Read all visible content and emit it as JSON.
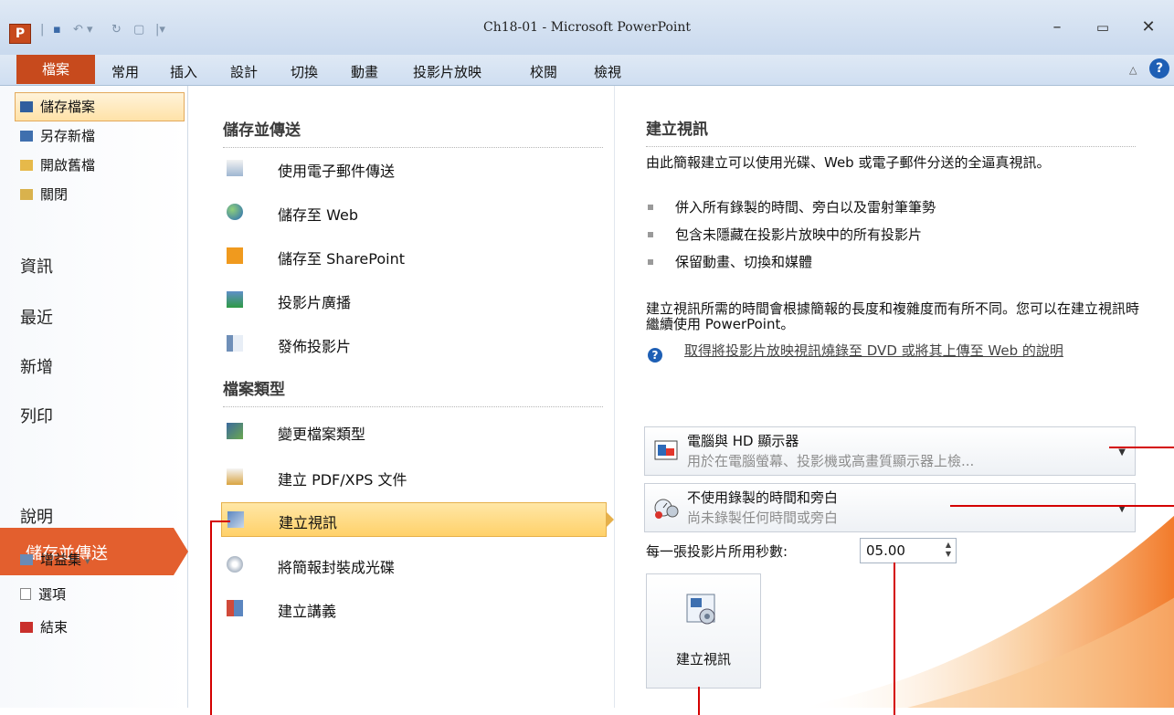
{
  "window": {
    "title": "Ch18-01 - Microsoft PowerPoint",
    "app_logo": "P",
    "controls": [
      "minimize-icon",
      "maximize-icon",
      "close-icon"
    ]
  },
  "ribbon": {
    "tabs": [
      "檔案",
      "常用",
      "插入",
      "設計",
      "切換",
      "動畫",
      "投影片放映",
      "校閱",
      "檢視"
    ],
    "help_icon": "?"
  },
  "sidebar": {
    "commands": [
      {
        "label": "儲存檔案",
        "icon": "save-icon"
      },
      {
        "label": "另存新檔",
        "icon": "save-as-icon"
      },
      {
        "label": "開啟舊檔",
        "icon": "open-folder-icon"
      },
      {
        "label": "關閉",
        "icon": "close-folder-icon"
      }
    ],
    "nav": [
      "資訊",
      "最近",
      "新增",
      "列印",
      "儲存並傳送",
      "說明"
    ],
    "bottom": [
      {
        "label": "增益集",
        "icon": "addins-icon",
        "suffix": "▾"
      },
      {
        "label": "選項",
        "icon": "options-icon"
      },
      {
        "label": "結束",
        "icon": "exit-icon"
      }
    ]
  },
  "middle": {
    "section1_title": "儲存並傳送",
    "section1_items": [
      {
        "label": "使用電子郵件傳送",
        "icon": "email-icon"
      },
      {
        "label": "儲存至 Web",
        "icon": "globe-icon"
      },
      {
        "label": "儲存至 SharePoint",
        "icon": "sharepoint-icon"
      },
      {
        "label": "投影片廣播",
        "icon": "broadcast-icon"
      },
      {
        "label": "發佈投影片",
        "icon": "publish-icon"
      }
    ],
    "section2_title": "檔案類型",
    "section2_items": [
      {
        "label": "變更檔案類型",
        "icon": "change-type-icon"
      },
      {
        "label": "建立 PDF/XPS 文件",
        "icon": "pdf-icon"
      },
      {
        "label": "建立視訊",
        "icon": "video-icon"
      },
      {
        "label": "將簡報封裝成光碟",
        "icon": "cd-icon"
      },
      {
        "label": "建立講義",
        "icon": "handout-icon"
      }
    ]
  },
  "right": {
    "title": "建立視訊",
    "intro": "由此簡報建立可以使用光碟、Web 或電子郵件分送的全逼真視訊。",
    "bullets": [
      "併入所有錄製的時間、旁白以及雷射筆筆勢",
      "包含未隱藏在投影片放映中的所有投影片",
      "保留動畫、切換和媒體"
    ],
    "note": "建立視訊所需的時間會根據簡報的長度和複雜度而有所不同。您可以在建立視訊時繼續使用 PowerPoint。",
    "help_link": "取得將投影片放映視訊燒錄至 DVD 或將其上傳至 Web 的說明",
    "dropdown1": {
      "title": "電腦與 HD 顯示器",
      "sub": "用於在電腦螢幕、投影機或高畫質顯示器上檢..."
    },
    "dropdown2": {
      "title": "不使用錄製的時間和旁白",
      "sub": "尚未錄製任何時間或旁白"
    },
    "seconds_label": "每一張投影片所用秒數:",
    "seconds_value": "05.00",
    "create_button": "建立視訊"
  },
  "colors": {
    "file_tab": "#c74a1d",
    "active_nav": "#e35f2e",
    "highlight": "#ffd16a",
    "callout": "#d40000"
  }
}
